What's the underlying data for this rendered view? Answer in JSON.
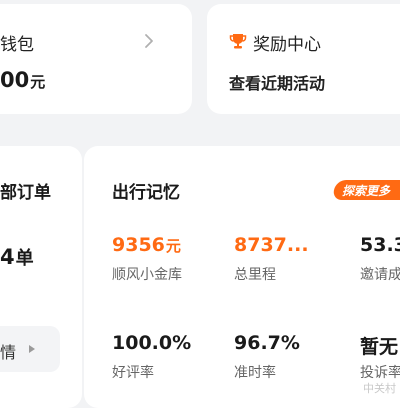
{
  "wallet": {
    "title": "钱包",
    "amount": "00",
    "unit": "元"
  },
  "reward": {
    "title": "奖励中心",
    "subtitle": "查看近期活动"
  },
  "orders": {
    "title": "部订单",
    "count": "4",
    "unit": "单",
    "detail_label": "情"
  },
  "memory": {
    "title": "出行记忆",
    "explore_label": "探索更多",
    "stats": [
      {
        "value": "9356",
        "unit": "元",
        "label": "顺风小金库",
        "color": "#ff6a13"
      },
      {
        "value": "8737...",
        "unit": "",
        "label": "总里程",
        "color": "#ff6a13"
      },
      {
        "value": "53.3",
        "unit": "",
        "label": "邀请成",
        "color": "#1a1a1a"
      },
      {
        "value": "100.0%",
        "unit": "",
        "label": "好评率",
        "color": "#1a1a1a"
      },
      {
        "value": "96.7%",
        "unit": "",
        "label": "准时率",
        "color": "#1a1a1a"
      },
      {
        "value": "暂无",
        "unit": "",
        "label": "投诉率",
        "color": "#1a1a1a"
      }
    ]
  },
  "watermark": "中关村",
  "colors": {
    "accent": "#ff6a13",
    "background": "#f2f3f5",
    "card": "#ffffff"
  },
  "icons": {
    "wallet_link": "chevron-right-icon",
    "reward": "trophy-icon",
    "detail_arrow": "triangle-right-icon"
  }
}
